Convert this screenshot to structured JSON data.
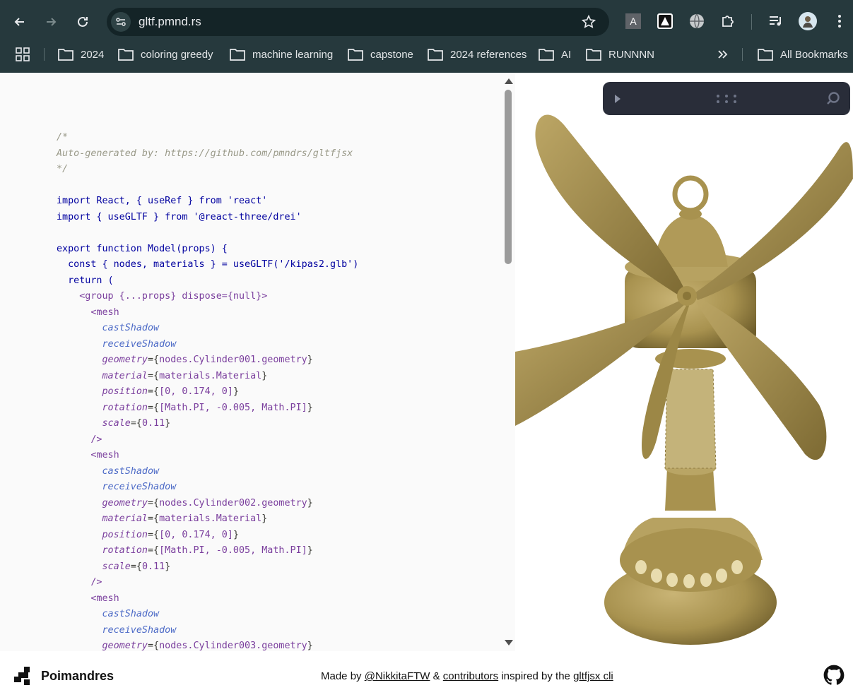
{
  "browser": {
    "url": "gltf.pmnd.rs",
    "bookmarks": [
      "2024",
      "coloring greedy",
      "machine learning",
      "capstone",
      "2024 references",
      "AI",
      "RUNNNN"
    ],
    "all_bookmarks_label": "All Bookmarks",
    "colors": {
      "toolbar_bg": "#26393d",
      "omnibox_bg": "#142427"
    }
  },
  "code": {
    "comment_open": "/*",
    "comment_body": "Auto-generated by: https://github.com/pmndrs/gltfjsx",
    "comment_close": "*/",
    "import_react": "import React, { useRef } from 'react'",
    "import_drei": "import { useGLTF } from '@react-three/drei'",
    "export_line": "export function Model(props) {",
    "const_line": "const { nodes, materials } = useGLTF('/kipas2.glb')",
    "return_line": "return (",
    "group_line": "<group {...props} dispose={null}>",
    "meshes": [
      {
        "geometry": "nodes.Cylinder001.geometry"
      },
      {
        "geometry": "nodes.Cylinder002.geometry"
      },
      {
        "geometry": "nodes.Cylinder003.geometry"
      }
    ],
    "mesh_open": "<mesh",
    "mesh_close": "/>",
    "cast": "castShadow",
    "receive": "receiveShadow",
    "material": "materials.Material",
    "position": "[0, 0.174, 0]",
    "rotation": "[Math.PI, -0.005, Math.PI]",
    "scale": "0.11"
  },
  "viewer": {
    "model_color": "#a8924f",
    "panel_bg": "#292d39"
  },
  "footer": {
    "brand": "Poimandres",
    "made_by": "Made by",
    "author": "@NikkitaFTW",
    "amp": "&",
    "contributors": "contributors",
    "inspired": "inspired by the",
    "cli": "gltfjsx cli"
  }
}
